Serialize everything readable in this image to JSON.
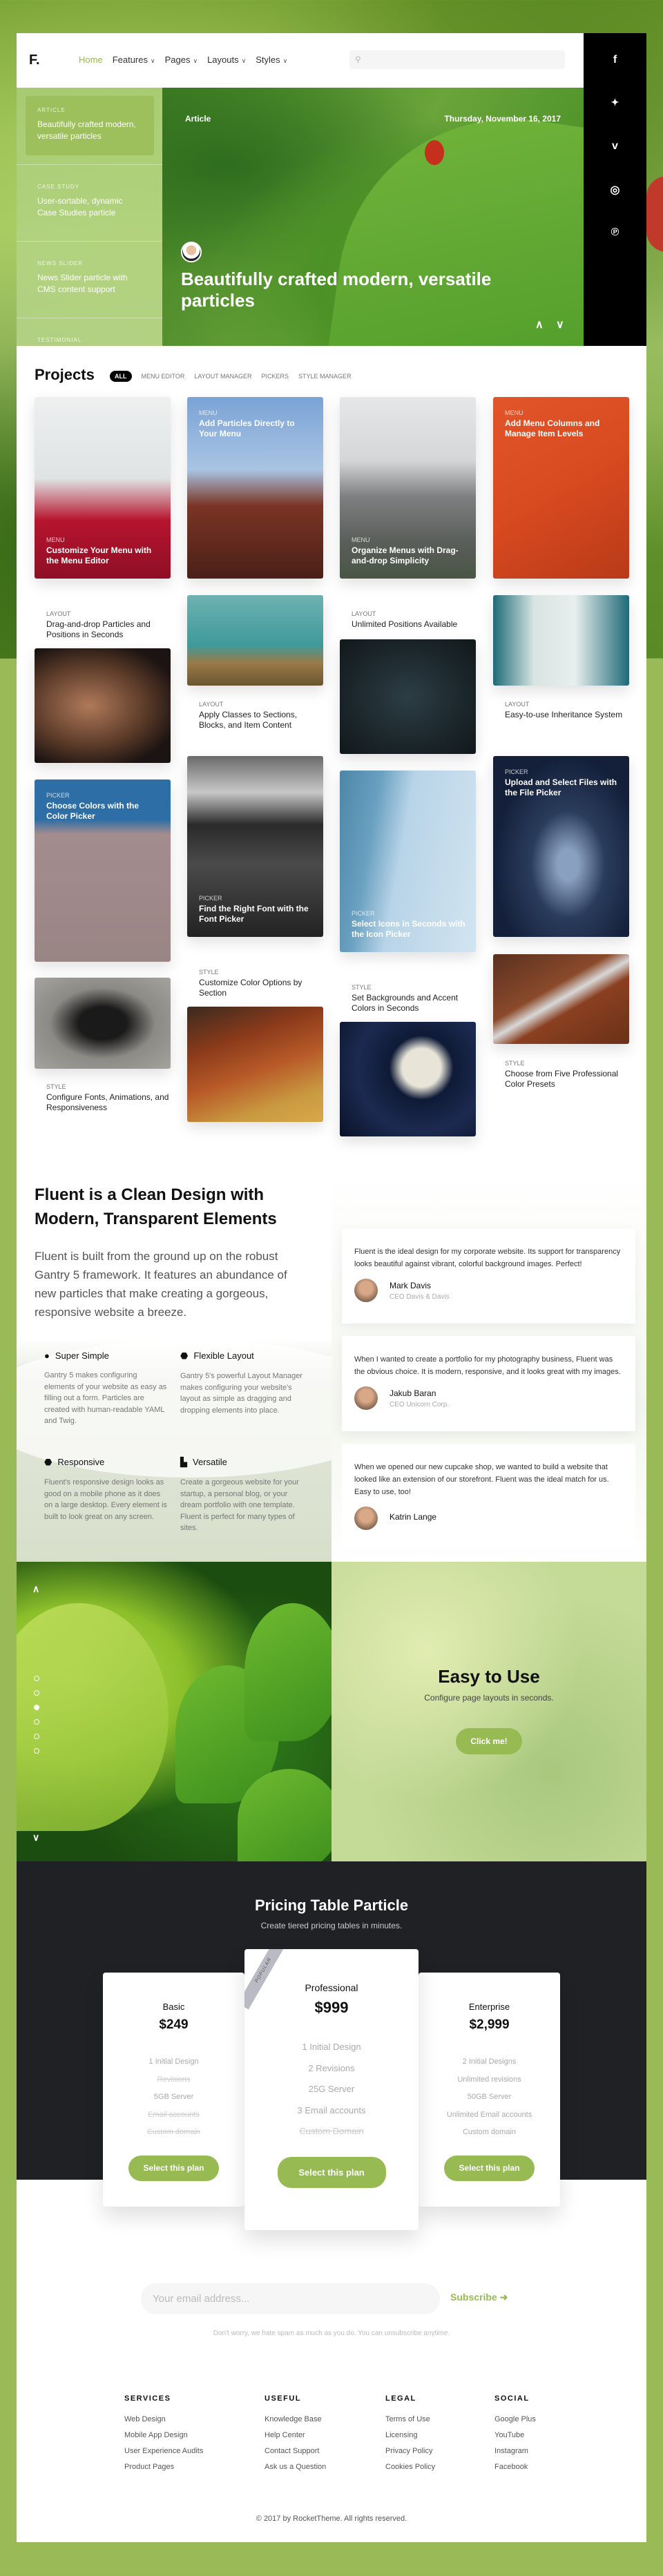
{
  "colors": {
    "accent": "#97bb52",
    "page_bg": "#9aba57",
    "pricing_bg": "#202125",
    "social_bar": "#000000"
  },
  "header": {
    "logo": "F.",
    "nav": [
      {
        "label": "Home",
        "active": true
      },
      {
        "label": "Features"
      },
      {
        "label": "Pages"
      },
      {
        "label": "Layouts"
      },
      {
        "label": "Styles"
      }
    ],
    "search_placeholder": ""
  },
  "social": [
    {
      "icon": "facebook-icon",
      "glyph": "f"
    },
    {
      "icon": "twitter-icon",
      "glyph": "🐦"
    },
    {
      "icon": "vimeo-icon",
      "glyph": "v"
    },
    {
      "icon": "instagram-icon",
      "glyph": "◎"
    },
    {
      "icon": "pinterest-icon",
      "glyph": "℗"
    }
  ],
  "sidebar": [
    {
      "label": "ARTICLE",
      "text": "Beautifully crafted modern, versatile particles",
      "active": true
    },
    {
      "label": "CASE STUDY",
      "text": "User-sortable, dynamic Case Studies particle"
    },
    {
      "label": "NEWS SLIDER",
      "text": "News Slider particle with CMS content support"
    },
    {
      "label": "TESTIMONIAL",
      "text": ""
    }
  ],
  "hero": {
    "category": "Article",
    "date": "Thursday, November 16, 2017",
    "title": "Beautifully crafted modern, versatile particles"
  },
  "projects": {
    "title": "Projects",
    "filters": [
      "ALL",
      "MENU EDITOR",
      "LAYOUT MANAGER",
      "PICKERS",
      "STYLE MANAGER"
    ],
    "items": [
      {
        "cat": "MENU",
        "title": "Customize Your Menu with the Menu Editor"
      },
      {
        "cat": "LAYOUT",
        "title": "Drag-and-drop Particles and Positions in Seconds"
      },
      {
        "cat": "PICKER",
        "title": "Choose Colors with the Color Picker"
      },
      {
        "cat": "STYLE",
        "title": "Configure Fonts, Animations, and Responsiveness"
      },
      {
        "cat": "MENU",
        "title": "Add Particles Directly to Your Menu"
      },
      {
        "cat": "LAYOUT",
        "title": "Apply Classes to Sections, Blocks, and Item Content"
      },
      {
        "cat": "PICKER",
        "title": "Find the Right Font with the Font Picker"
      },
      {
        "cat": "STYLE",
        "title": "Customize Color Options by Section"
      },
      {
        "cat": "MENU",
        "title": "Organize Menus with Drag-and-drop Simplicity"
      },
      {
        "cat": "LAYOUT",
        "title": "Unlimited Positions Available"
      },
      {
        "cat": "PICKER",
        "title": "Select Icons in Seconds with the Icon Picker"
      },
      {
        "cat": "STYLE",
        "title": "Set Backgrounds and Accent Colors in Seconds"
      },
      {
        "cat": "MENU",
        "title": "Add Menu Columns and Manage Item Levels"
      },
      {
        "cat": "LAYOUT",
        "title": "Easy-to-use Inheritance System"
      },
      {
        "cat": "PICKER",
        "title": "Upload and Select Files with the File Picker"
      },
      {
        "cat": "STYLE",
        "title": "Choose from Five Professional Color Presets"
      }
    ]
  },
  "fluent": {
    "heading": "Fluent is a Clean Design with Modern, Transparent Elements",
    "intro": "Fluent is built from the ground up on the robust Gantry 5 framework. It features an abundance of new particles that make creating a gorgeous, responsive website a breeze.",
    "features": [
      {
        "icon": "apple-icon",
        "glyph": "",
        "title": "Super Simple",
        "text": "Gantry 5 makes configuring elements of your website as easy as filling out a form. Particles are created with human-readable YAML and Twig."
      },
      {
        "icon": "android-icon",
        "glyph": "⬣",
        "title": "Flexible Layout",
        "text": "Gantry 5's powerful Layout Manager makes configuring your website's layout as simple as dragging and dropping elements into place."
      },
      {
        "icon": "android-icon",
        "glyph": "⬣",
        "title": "Responsive",
        "text": "Fluent's responsive design looks as good on a mobile phone as it does on a large desktop. Every element is built to look great on any screen."
      },
      {
        "icon": "bathtub-icon",
        "glyph": "🛁",
        "title": "Versatile",
        "text": "Create a gorgeous website for your startup, a personal blog, or your dream portfolio with one template. Fluent is perfect for many types of sites."
      }
    ],
    "testimonials": [
      {
        "quote": "Fluent is the ideal design for my corporate website. Its support for transparency looks beautiful against vibrant, colorful background images. Perfect!",
        "name": "Mark Davis",
        "role": "CEO Davis & Davis"
      },
      {
        "quote": "When I wanted to create a portfolio for my photography business, Fluent was the obvious choice. It is modern, responsive, and it looks great with my images.",
        "name": "Jakub Baran",
        "role": "CEO Unicorn Corp."
      },
      {
        "quote": "When we opened our new cupcake shop, we wanted to build a website that looked like an extension of our storefront. Fluent was the ideal match for us. Easy to use, too!",
        "name": "Katrin Lange",
        "role": ""
      }
    ]
  },
  "showcase": {
    "title": "Easy to Use",
    "subtitle": "Configure page layouts in seconds.",
    "button": "Click me!",
    "slides_total": 6,
    "active_slide": 3
  },
  "pricing": {
    "title": "Pricing Table Particle",
    "subtitle": "Create tiered pricing tables in minutes.",
    "ribbon": "POPULAR",
    "plans": [
      {
        "name": "Basic",
        "price": "$249",
        "features": [
          {
            "t": "1 Initial Design"
          },
          {
            "t": "Revisions",
            "x": true
          },
          {
            "t": "5GB Server"
          },
          {
            "t": "Email accounts",
            "x": true
          },
          {
            "t": "Custom domain",
            "x": true
          }
        ],
        "button": "Select this plan"
      },
      {
        "name": "Professional",
        "price": "$999",
        "features": [
          {
            "t": "1 Initial Design"
          },
          {
            "t": "2 Revisions"
          },
          {
            "t": "25G Server"
          },
          {
            "t": "3 Email accounts"
          },
          {
            "t": "Custom Domain",
            "x": true
          }
        ],
        "button": "Select this plan"
      },
      {
        "name": "Enterprise",
        "price": "$2,999",
        "features": [
          {
            "t": "2 Initial Designs"
          },
          {
            "t": "Unlimited revisions"
          },
          {
            "t": "50GB Server"
          },
          {
            "t": "Unlimited Email accounts"
          },
          {
            "t": "Custom domain"
          }
        ],
        "button": "Select this plan"
      }
    ]
  },
  "newsletter": {
    "placeholder": "Your email address...",
    "button": "Subscribe",
    "note": "Don't worry, we hate spam as much as you do. You can unsubscribe anytime."
  },
  "footer": {
    "columns": [
      {
        "title": "SERVICES",
        "items": [
          "Web Design",
          "Mobile App Design",
          "User Experience Audits",
          "Product Pages"
        ]
      },
      {
        "title": "USEFUL",
        "items": [
          "Knowledge Base",
          "Help Center",
          "Contact Support",
          "Ask us a Question"
        ]
      },
      {
        "title": "LEGAL",
        "items": [
          "Terms of Use",
          "Licensing",
          "Privacy Policy",
          "Cookies Policy"
        ]
      },
      {
        "title": "SOCIAL",
        "items": [
          "Google Plus",
          "YouTube",
          "Instagram",
          "Facebook"
        ]
      }
    ],
    "copyright": "© 2017 by RocketTheme. All rights reserved."
  }
}
